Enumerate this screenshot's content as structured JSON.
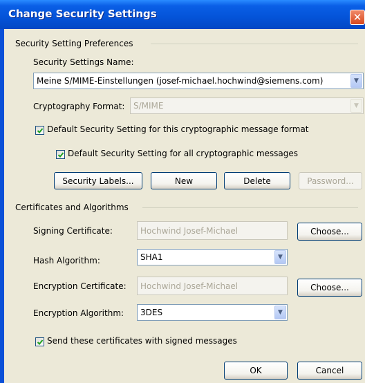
{
  "window": {
    "title": "Change Security Settings",
    "close_glyph": "✕"
  },
  "prefs": {
    "group_label": "Security Setting Preferences",
    "name_label": "Security Settings Name:",
    "name_value": "Meine S/MIME-Einstellungen (josef-michael.hochwind@siemens.com)",
    "format_label": "Cryptography Format:",
    "format_value": "S/MIME",
    "default_format_label": "Default Security Setting for this cryptographic message format",
    "default_format_checked": true,
    "default_all_label": "Default Security Setting for all cryptographic messages",
    "default_all_checked": true,
    "buttons": {
      "security_labels": "Security Labels...",
      "new": "New",
      "delete": "Delete",
      "password": "Password..."
    }
  },
  "certs": {
    "group_label": "Certificates and Algorithms",
    "signing_label": "Signing Certificate:",
    "signing_value": "Hochwind Josef-Michael",
    "choose_label": "Choose...",
    "hash_label": "Hash Algorithm:",
    "hash_value": "SHA1",
    "encryption_label": "Encryption Certificate:",
    "encryption_value": "Hochwind Josef-Michael",
    "enc_alg_label": "Encryption Algorithm:",
    "enc_alg_value": "3DES",
    "send_certs_label": "Send these certificates with signed messages",
    "send_certs_checked": true
  },
  "footer": {
    "ok": "OK",
    "cancel": "Cancel"
  },
  "colors": {
    "title_bar": "#0453d8",
    "dialog_bg": "#ece9d8",
    "close_button": "#d8481e"
  }
}
